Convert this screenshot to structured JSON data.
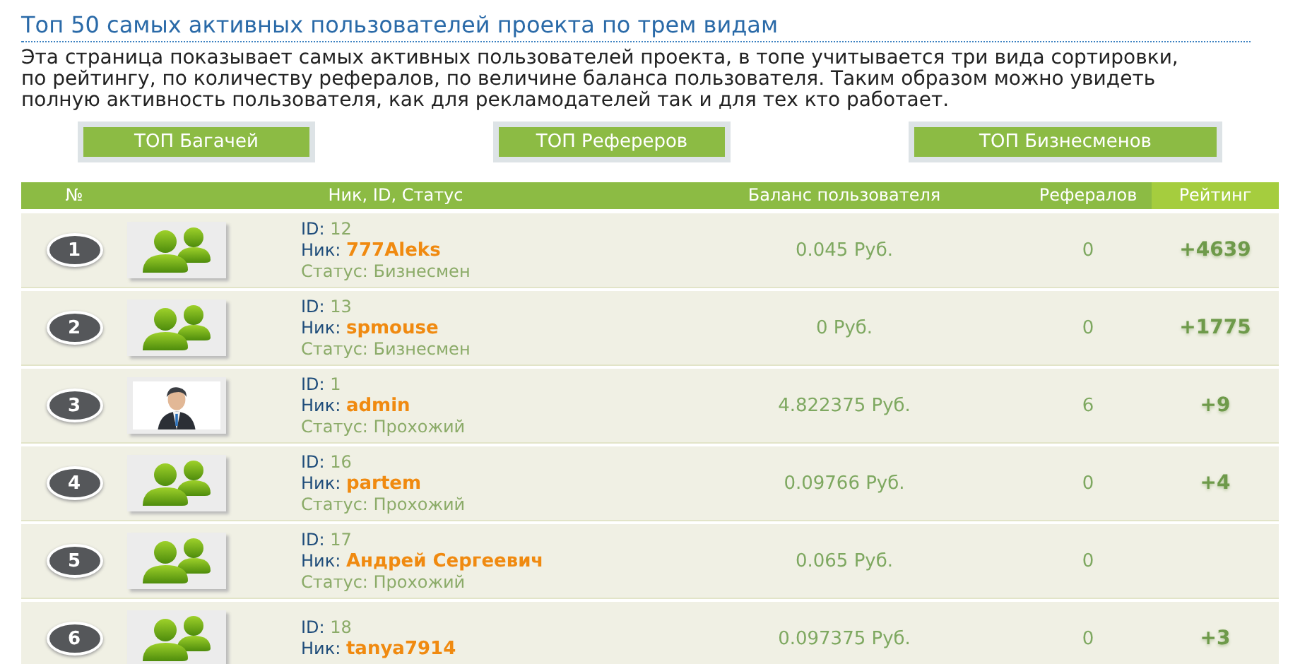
{
  "title": "Топ 50 самых активных пользователей проекта по трем видам",
  "description": "Эта страница показывает самых активных пользователей проекта, в топе учитывается три вида сортировки, по рейтингу, по количеству рефералов, по величине баланса пользователя. Таким образом можно увидеть полную активность пользователя, как для рекламодателей так и для тех кто работает.",
  "buttons": [
    "ТОП Багачей",
    "ТОП Рефереров",
    "ТОП Бизнесменов"
  ],
  "table": {
    "columns": [
      {
        "label": "№",
        "selected": false
      },
      {
        "label": "Ник, ID, Статус",
        "selected": false
      },
      {
        "label": "Баланс пользователя",
        "selected": false
      },
      {
        "label": "Рефералов",
        "selected": false
      },
      {
        "label": "Рейтинг",
        "selected": true
      }
    ],
    "rows": [
      {
        "rank": "1",
        "avatar": {
          "kind": "group"
        },
        "id_label": "ID:",
        "id": "12",
        "nick_label": "Ник:",
        "nick": "777Aleks",
        "status": "Статус: Бизнесмен",
        "balance": "0.045 Руб.",
        "referrals": "0",
        "rating": "+4639"
      },
      {
        "rank": "2",
        "avatar": {
          "kind": "group"
        },
        "id_label": "ID:",
        "id": "13",
        "nick_label": "Ник:",
        "nick": "spmouse",
        "status": "Статус: Бизнесмен",
        "balance": "0 Руб.",
        "referrals": "0",
        "rating": "+1775"
      },
      {
        "rank": "3",
        "id_label": "ID:",
        "id": "1",
        "nick_label": "Ник:",
        "nick": "admin",
        "status": "Статус: Прохожий",
        "balance": "4.822375 Руб.",
        "referrals": "6",
        "rating": "+9"
      },
      {
        "rank": "4",
        "avatar": {
          "kind": "group"
        },
        "id_label": "ID:",
        "id": "16",
        "nick_label": "Ник:",
        "nick": "partem",
        "status": "Статус: Прохожий",
        "balance": "0.09766 Руб.",
        "referrals": "0",
        "rating": "+4"
      },
      {
        "rank": "5",
        "avatar": {
          "kind": "group"
        },
        "id_label": "ID:",
        "id": "17",
        "nick_label": "Ник:",
        "nick": "Андрей Сергеевич",
        "status": "Статус: Прохожий",
        "balance": "0.065 Руб.",
        "referrals": "0"
      },
      {
        "rank": "6",
        "avatar": {
          "kind": "group"
        },
        "id_label": "ID:",
        "id": "18",
        "nick_label": "Ник:",
        "nick": "tanya7914",
        "balance": "0.097375 Руб.",
        "referrals": "0",
        "rating": "+3"
      }
    ]
  }
}
